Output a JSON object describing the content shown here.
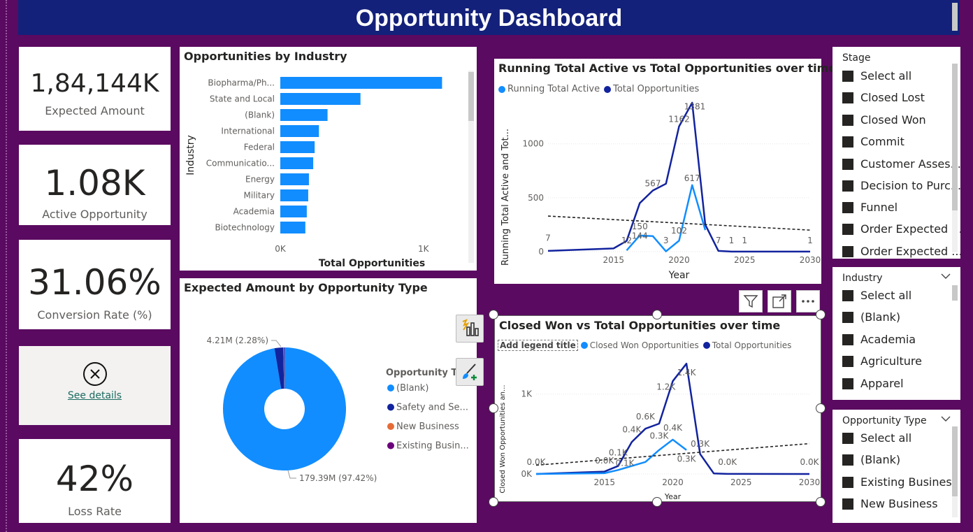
{
  "header": {
    "title": "Opportunity Dashboard"
  },
  "kpis": {
    "expected_amount": {
      "value": "1,84,144K",
      "label": "Expected Amount"
    },
    "active_opportunity": {
      "value": "1.08K",
      "label": "Active Opportunity"
    },
    "conversion_rate": {
      "value": "31.06%",
      "label": "Conversion Rate (%)"
    },
    "error_card": {
      "link": "See details",
      "icon": "close-circle-icon"
    },
    "loss_rate": {
      "value": "42%",
      "label": "Loss Rate"
    }
  },
  "industry_chart": {
    "title": "Opportunities by Industry",
    "chart_data": {
      "type": "bar",
      "orientation": "horizontal",
      "categories": [
        "Biopharma/Ph...",
        "State and Local",
        "(Blank)",
        "International",
        "Federal",
        "Communicatio...",
        "Energy",
        "Military",
        "Academia",
        "Biotechnology"
      ],
      "values": [
        1130,
        560,
        330,
        270,
        240,
        230,
        200,
        195,
        185,
        175
      ],
      "xlabel": "Total Opportunities",
      "ylabel": "Industry",
      "xticks": [
        "0K",
        "1K"
      ],
      "xlim": [
        0,
        1250
      ],
      "color": "#118dff"
    }
  },
  "running_total_chart": {
    "title": "Running Total Active vs Total Opportunities over time",
    "legend": [
      "Running Total Active",
      "Total Opportunities"
    ],
    "chart_data": {
      "type": "line",
      "xlabel": "Year",
      "ylabel": "Running Total Active and Tot...",
      "xlim": [
        2010,
        2030
      ],
      "ylim": [
        0,
        1400
      ],
      "xticks": [
        "2015",
        "2020",
        "2025",
        "2030"
      ],
      "yticks": [
        "0",
        "500",
        "1000"
      ],
      "series": [
        {
          "name": "Total Opportunities",
          "color": "#12239e",
          "x": [
            2010,
            2015,
            2016,
            2017,
            2018,
            2019,
            2020,
            2021,
            2022,
            2023,
            2024,
            2025,
            2030
          ],
          "y": [
            7,
            30,
            100,
            450,
            567,
            630,
            1162,
            1381,
            250,
            7,
            1,
            1,
            1
          ]
        },
        {
          "name": "Running Total Active",
          "color": "#118dff",
          "x": [
            2016,
            2017,
            2018,
            2019,
            2020,
            2021,
            2022
          ],
          "y": [
            12,
            150,
            144,
            3,
            102,
            617,
            200
          ]
        }
      ],
      "trendline": {
        "color": "#222",
        "style": "dashed"
      },
      "data_labels": [
        "7",
        "12",
        "150",
        "144",
        "567",
        "3",
        "102",
        "1162",
        "617",
        "1381",
        "7",
        "1",
        "1",
        "1"
      ]
    }
  },
  "closed_won_chart": {
    "title": "Closed Won vs Total Opportunities over time",
    "legend_title": "Add legend title",
    "legend": [
      "Closed Won Opportunities",
      "Total Opportunities"
    ],
    "chart_data": {
      "type": "line",
      "xlabel": "Year",
      "ylabel": "Closed Won Opportunities an...",
      "xlim": [
        2010,
        2030
      ],
      "ylim": [
        0,
        1400
      ],
      "xticks": [
        "2015",
        "2020",
        "2025",
        "2030"
      ],
      "yticks": [
        "0K",
        "1K"
      ],
      "series": [
        {
          "name": "Total Opportunities",
          "color": "#12239e",
          "x": [
            2010,
            2015,
            2016,
            2017,
            2018,
            2019,
            2020,
            2021,
            2022,
            2023,
            2024,
            2025,
            2030
          ],
          "y": [
            0,
            30,
            100,
            400,
            567,
            630,
            1162,
            1381,
            250,
            7,
            1,
            1,
            0
          ]
        },
        {
          "name": "Closed Won Opportunities",
          "color": "#118dff",
          "x": [
            2010,
            2015,
            2016,
            2017,
            2018,
            2019,
            2020,
            2021
          ],
          "y": [
            0,
            10,
            50,
            100,
            150,
            300,
            430,
            300
          ]
        }
      ],
      "trendline": {
        "color": "#222",
        "style": "dashed"
      },
      "data_labels": [
        "0.0K",
        "0.0K",
        "0.1K",
        "0.1K",
        "0.4K",
        "0.6K",
        "0.3K",
        "1.2K",
        "0.4K",
        "1.4K",
        "0.3K",
        "0.3K",
        "0.0K",
        "0.0K"
      ]
    }
  },
  "donut_chart": {
    "title": "Expected Amount by Opportunity Type",
    "legend_title": "Opportunity Ty",
    "chart_data": {
      "type": "pie",
      "donut": true,
      "slices": [
        {
          "name": "(Blank)",
          "value": 179.39,
          "percent": 97.42,
          "label": "179.39M (97.42%)",
          "color": "#118dff"
        },
        {
          "name": "Safety and Se...",
          "value": 4.21,
          "percent": 2.28,
          "label": "4.21M (2.28%)",
          "color": "#12239e"
        },
        {
          "name": "New Business",
          "value": 0.3,
          "percent": 0.15,
          "color": "#e66c37"
        },
        {
          "name": "Existing Busin...",
          "value": 0.3,
          "percent": 0.15,
          "color": "#6b007b"
        }
      ]
    }
  },
  "slicers": {
    "stage": {
      "title": "Stage",
      "items": [
        "Select all",
        "Closed Lost",
        "Closed Won",
        "Commit",
        "Customer Asses...",
        "Decision to Purc...",
        "Funnel",
        "Order Expected ...",
        "Order Expected ..."
      ]
    },
    "industry": {
      "title": "Industry",
      "items": [
        "Select all",
        "(Blank)",
        "Academia",
        "Agriculture",
        "Apparel"
      ]
    },
    "opportunity_type": {
      "title": "Opportunity Type",
      "items": [
        "Select all",
        "(Blank)",
        "Existing Business",
        "New Business"
      ]
    }
  },
  "toolbar": {
    "icons": [
      "filter-icon",
      "focus-mode-icon",
      "more-options-icon"
    ]
  },
  "side_buttons": {
    "icons": [
      "build-visual-icon",
      "format-visual-icon"
    ]
  }
}
